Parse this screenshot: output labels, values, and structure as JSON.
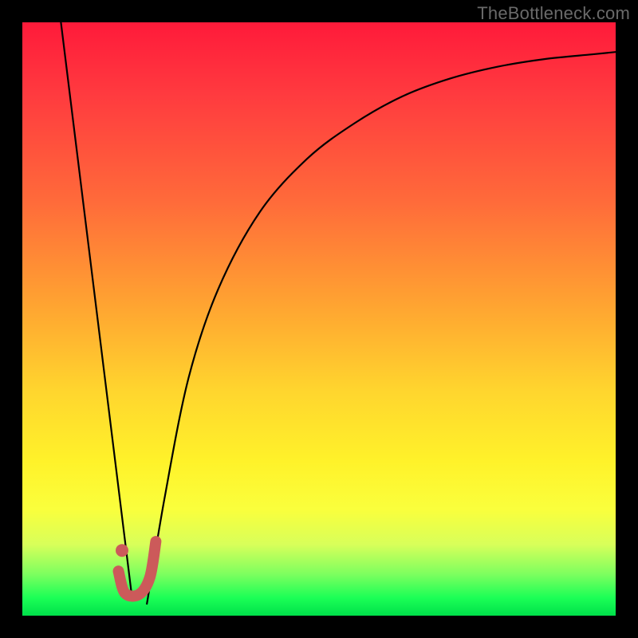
{
  "watermark": "TheBottleneck.com",
  "colors": {
    "gradient_top": "#ff1a3a",
    "gradient_mid": "#ffd52e",
    "gradient_bottom": "#00e04a",
    "curve_stroke": "#000000",
    "marker_stroke": "#cc5a5a",
    "marker_fill": "#cc5a5a",
    "frame_bg": "#000000"
  },
  "chart_data": {
    "type": "line",
    "title": "",
    "xlabel": "",
    "ylabel": "",
    "xlim": [
      0,
      100
    ],
    "ylim": [
      0,
      100
    ],
    "grid": false,
    "legend": false,
    "series": [
      {
        "name": "left-descending-line",
        "x": [
          6.5,
          18.5
        ],
        "values": [
          100,
          3
        ]
      },
      {
        "name": "right-rising-curve",
        "x": [
          21,
          24,
          28,
          33,
          40,
          48,
          56,
          64,
          72,
          80,
          88,
          96,
          100
        ],
        "values": [
          2,
          20,
          40,
          55,
          68,
          77,
          83,
          87.5,
          90.5,
          92.5,
          93.8,
          94.6,
          95
        ]
      }
    ],
    "marker": {
      "name": "J-marker",
      "dot": {
        "x": 16.8,
        "y": 11
      },
      "hook_path": [
        {
          "x": 16.2,
          "y": 7.5
        },
        {
          "x": 17.3,
          "y": 3.8
        },
        {
          "x": 19.7,
          "y": 3.6
        },
        {
          "x": 21.5,
          "y": 6.5
        },
        {
          "x": 22.5,
          "y": 12.5
        }
      ]
    },
    "annotations": []
  }
}
